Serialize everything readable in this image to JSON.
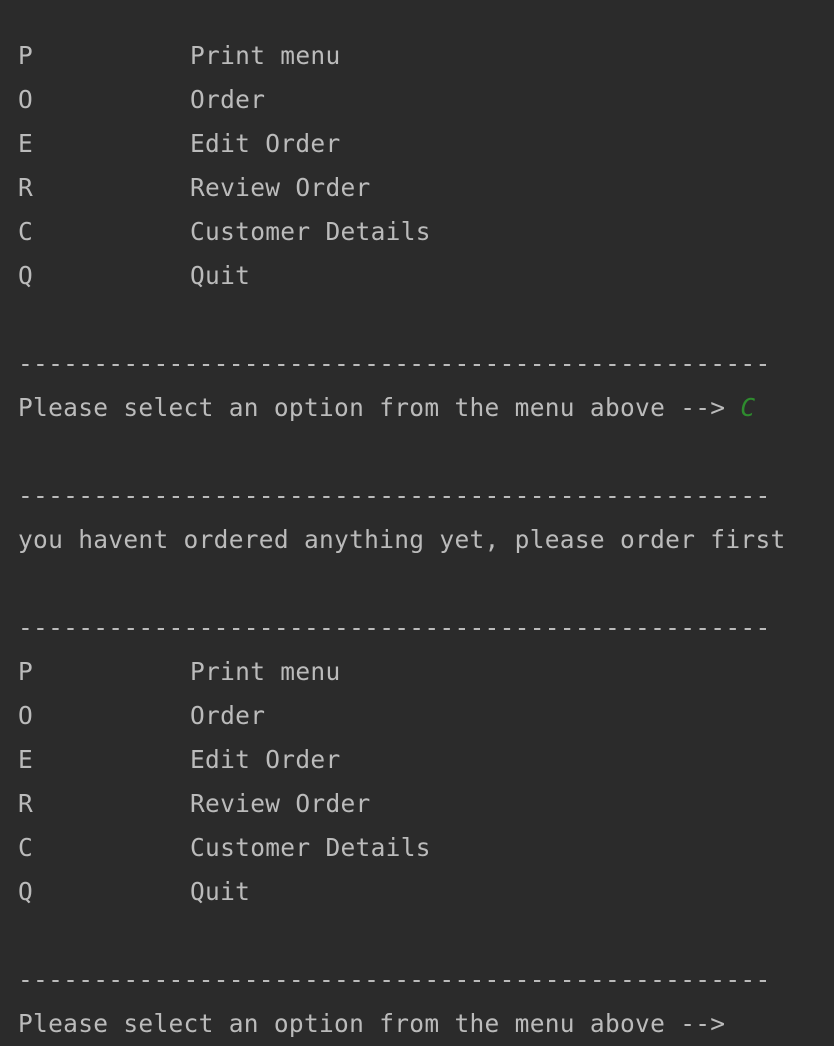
{
  "top_partial": "                                                                  ",
  "menu_block_1": [
    {
      "key": "P",
      "label": "Print menu"
    },
    {
      "key": "O",
      "label": "Order"
    },
    {
      "key": "E",
      "label": "Edit Order"
    },
    {
      "key": "R",
      "label": "Review Order"
    },
    {
      "key": "C",
      "label": "Customer Details"
    },
    {
      "key": "Q",
      "label": "Quit"
    }
  ],
  "divider": "--------------------------------------------------",
  "prompt_1": {
    "text": "Please select an option from the menu above --> ",
    "input": "C"
  },
  "message": "you havent ordered anything yet, please order first",
  "menu_block_2": [
    {
      "key": "P",
      "label": "Print menu"
    },
    {
      "key": "O",
      "label": "Order"
    },
    {
      "key": "E",
      "label": "Edit Order"
    },
    {
      "key": "R",
      "label": "Review Order"
    },
    {
      "key": "C",
      "label": "Customer Details"
    },
    {
      "key": "Q",
      "label": "Quit"
    }
  ],
  "prompt_2": {
    "text": "Please select an option from the menu above -->"
  },
  "colors": {
    "background": "#2b2b2b",
    "text": "#bbbbbb",
    "user_input": "#2e8b2e"
  }
}
